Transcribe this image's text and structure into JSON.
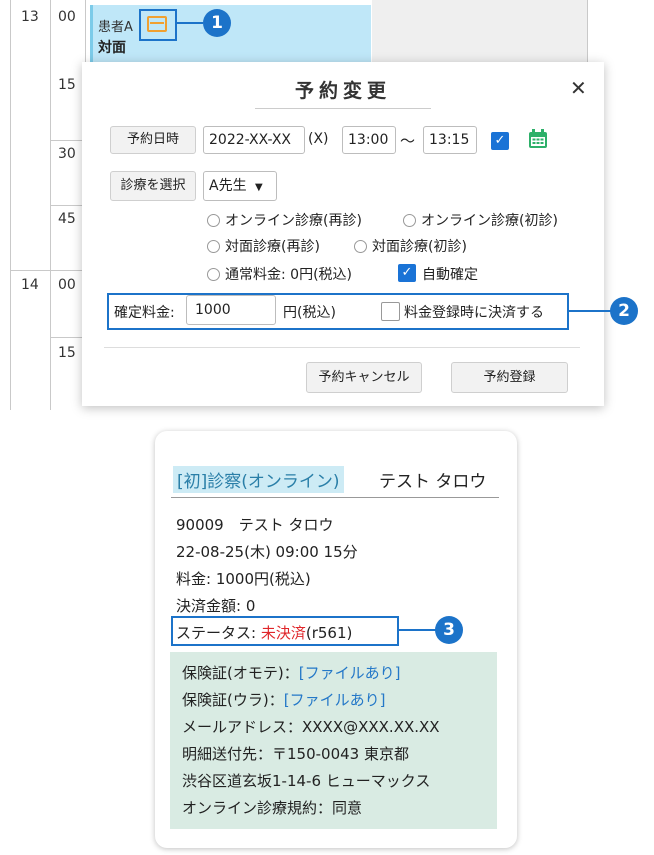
{
  "calendar": {
    "hours": [
      "13",
      "14"
    ],
    "minutes": [
      "00",
      "15",
      "30",
      "45",
      "00",
      "15"
    ],
    "appointment": {
      "patient": "患者A",
      "type": "対面"
    }
  },
  "callouts": [
    "1",
    "2",
    "3"
  ],
  "modal": {
    "title": "予約変更",
    "close_icon": "close-icon",
    "date_button": "予約日時",
    "date_value": "2022-XX-XX",
    "weekday": "(X)",
    "start_time": "13:00",
    "tilde": "〜",
    "end_time": "13:15",
    "time_checkbox_checked": true,
    "calendar_icon": "calendar-icon",
    "treatment_button": "診療を選択",
    "doctor_select": "A先生",
    "options": [
      {
        "label": "オンライン診療(再診)",
        "selected": false
      },
      {
        "label": "オンライン診療(初診)",
        "selected": false
      },
      {
        "label": "対面診療(再診)",
        "selected": false
      },
      {
        "label": "対面診療(初診)",
        "selected": false
      },
      {
        "label": "通常料金: 0円(税込)",
        "selected": false
      }
    ],
    "auto_confirm": {
      "label": "自動確定",
      "checked": true
    },
    "fee_label": "確定料金:",
    "fee_value": "1000",
    "fee_unit": "円(税込)",
    "settle_checkbox": {
      "label": "料金登録時に決済する",
      "checked": false
    },
    "cancel_button": "予約キャンセル",
    "register_button": "予約登録"
  },
  "card": {
    "tag": "[初]診察(オンライン)",
    "name": "テスト タロウ",
    "lines": [
      "90009　テスト タロウ",
      "22-08-25(木) 09:00 15分",
      "料金: 1000円(税込)",
      "決済金額: 0"
    ],
    "status_label": "ステータス: ",
    "status_value": "未決済",
    "status_code": "(r561)",
    "insurance_front_label": "保険証(オモテ)：",
    "insurance_front_value": "[ファイルあり]",
    "insurance_back_label": "保険証(ウラ)：",
    "insurance_back_value": "[ファイルあり]",
    "email": "メールアドレス：XXXX@XXX.XX.XX",
    "address_line1": "明細送付先：〒150-0043 東京都",
    "address_line2": "渋谷区道玄坂1-14-6 ヒューマックス",
    "terms": "オンライン診療規約：同意"
  },
  "colors": {
    "accent": "#1c73c9",
    "appointment_bg": "#bfe7f8",
    "status_unpaid": "#e0262a",
    "panel_bg": "#d9ebe3",
    "checkbox": "#1a73d6"
  }
}
